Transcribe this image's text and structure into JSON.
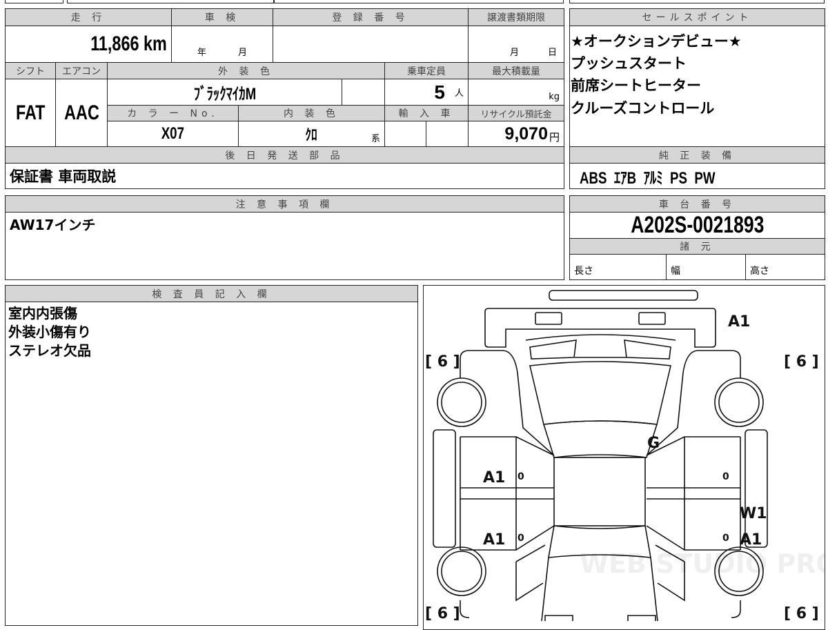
{
  "main": {
    "mileage_label": "走 行",
    "mileage": "11,866 km",
    "inspection_label": "車 検",
    "inspection_year": "年",
    "inspection_month": "月",
    "registration_label": "登 録 番 号",
    "registration": "",
    "transfer_deadline_label": "譲渡書類期限",
    "transfer_month": "月",
    "transfer_day": "日",
    "shift_label": "シフト",
    "shift": "FAT",
    "ac_label": "エアコン",
    "ac": "AAC",
    "exterior_color_label": "外 装 色",
    "exterior_color": "ﾌﾞﾗｯｸﾏｲｶM",
    "capacity_label": "乗車定員",
    "capacity": "5",
    "capacity_unit": "人",
    "max_load_label": "最大積載量",
    "max_load_unit": "kg",
    "color_no_label": "カ ラ ー No.",
    "color_no": "X07",
    "interior_color_label": "内 装 色",
    "interior_color": "ｸﾛ",
    "interior_suffix": "系",
    "import_label": "輸 入 車",
    "recycle_label": "リサイクル預託金",
    "recycle": "9,070",
    "recycle_unit": "円",
    "later_parts_label": "後 日 発 送 部 品",
    "later_parts": "保証書 車両取説"
  },
  "sales_points": {
    "label": "セールスポイント",
    "items": [
      "★オークションデビュー★",
      "プッシュスタート",
      "前席シートヒーター",
      "クルーズコントロール"
    ]
  },
  "equipment": {
    "label": "純 正 装 備",
    "items": "ABS  ｴｱB  ｱﾙﾐ  PS  PW"
  },
  "notes": {
    "label": "注 意 事 項 欄",
    "text": "AW17インチ"
  },
  "chassis": {
    "label": "車 台 番 号",
    "number": "A202S-0021893",
    "specs_label": "諸 元",
    "length": "長さ",
    "width": "幅",
    "height": "高さ"
  },
  "inspector": {
    "label": "検 査 員 記 入 欄",
    "lines": [
      "室内内張傷",
      "外装小傷有り",
      "ステレオ欠品"
    ]
  },
  "diagram": {
    "front_bumper": "A1",
    "tire_fl": "[ 6 ]",
    "tire_fr": "[ 6 ]",
    "tire_rl": "[ 6 ]",
    "tire_rr": "[ 6 ]",
    "windshield": "G",
    "left_front_door": "A1",
    "left_rear_door": "A1",
    "right_rear_door_1": "W1",
    "right_rear_door_2": "A1",
    "door_marks": [
      "0",
      "0",
      "0",
      "0"
    ],
    "watermark": "WEB STUDIO PRO"
  }
}
